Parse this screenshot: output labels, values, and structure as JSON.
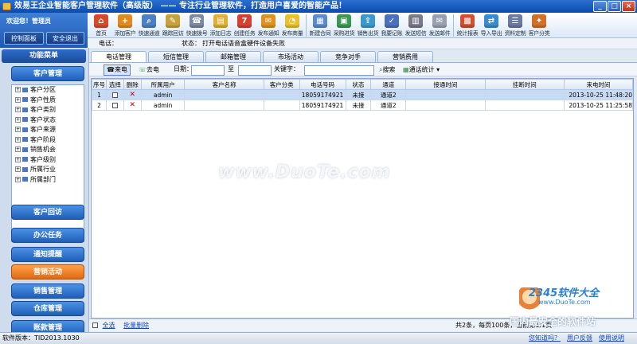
{
  "window": {
    "title": "效易王企业智能客户管理软件（高级版） —— 专注行业管理软件，打造用户喜爱的智能产品！"
  },
  "user_panel": {
    "welcome": "欢迎您！管理员",
    "control_btn": "控制面板",
    "logout_btn": "安全退出"
  },
  "toolbar": [
    {
      "label": "首页",
      "icon": "home-icon",
      "color": "#d84a2a",
      "glyph": "⌂"
    },
    {
      "label": "添加客户",
      "icon": "add-customer-icon",
      "color": "#e08a20",
      "glyph": "+"
    },
    {
      "label": "快速通道",
      "icon": "search-icon",
      "color": "#4a80c8",
      "glyph": "⌕"
    },
    {
      "label": "跟踪回访",
      "icon": "followup-icon",
      "color": "#c8a040",
      "glyph": "✎"
    },
    {
      "label": "快速拨号",
      "icon": "dial-icon",
      "color": "#7a8aa0",
      "glyph": "☎"
    },
    {
      "label": "添加日志",
      "icon": "log-icon",
      "color": "#e0b030",
      "glyph": "▤"
    },
    {
      "label": "创建任务",
      "icon": "calendar-icon",
      "color": "#d84030",
      "glyph": "7"
    },
    {
      "label": "发布通知",
      "icon": "notice-icon",
      "color": "#e09020",
      "glyph": "✉"
    },
    {
      "label": "发布商量",
      "icon": "chat-icon",
      "color": "#e8c030",
      "glyph": "◔"
    },
    {
      "label": "新建合同",
      "icon": "contract-icon",
      "color": "#5a8ad0",
      "glyph": "▦"
    },
    {
      "label": "采购进货",
      "icon": "purchase-icon",
      "color": "#3a9a50",
      "glyph": "▣"
    },
    {
      "label": "销售出货",
      "icon": "sales-icon",
      "color": "#3a9ad0",
      "glyph": "⇪"
    },
    {
      "label": "我要记账",
      "icon": "account-icon",
      "color": "#4a70c0",
      "glyph": "✓"
    },
    {
      "label": "发送短信",
      "icon": "sms-icon",
      "color": "#7a7a8a",
      "glyph": "▥"
    },
    {
      "label": "发送邮件",
      "icon": "mail-icon",
      "color": "#9aa0b0",
      "glyph": "✉"
    },
    {
      "label": "统计报表",
      "icon": "report-icon",
      "color": "#d05030",
      "glyph": "▩"
    },
    {
      "label": "导入导出",
      "icon": "import-export-icon",
      "color": "#3a8ad0",
      "glyph": "⇄"
    },
    {
      "label": "资料定制",
      "icon": "custom-icon",
      "color": "#6a7aa0",
      "glyph": "☰"
    },
    {
      "label": "客户分类",
      "icon": "category-icon",
      "color": "#d0702a",
      "glyph": "✦"
    }
  ],
  "status_line": {
    "phone_label": "电话：",
    "status_label": "状态：",
    "status_value": "打开电话语音盒硬件设备失败"
  },
  "sidebar": {
    "menu_title": "功能菜单",
    "top_button": "客户管理",
    "tree": [
      "客户分区",
      "客户性质",
      "客户类别",
      "客户状态",
      "客户来源",
      "客户阶段",
      "销售机会",
      "客户级别",
      "所属行业",
      "所属部门"
    ],
    "buttons": [
      {
        "label": "客户回访",
        "orange": false
      },
      {
        "label": "办公任务",
        "orange": false
      },
      {
        "label": "通知提醒",
        "orange": false
      },
      {
        "label": "营销活动",
        "orange": true
      },
      {
        "label": "销售管理",
        "orange": false
      },
      {
        "label": "仓库管理",
        "orange": false
      },
      {
        "label": "账款管理",
        "orange": false
      }
    ]
  },
  "tabs": [
    "电话管理",
    "短信管理",
    "邮箱管理",
    "市场活动",
    "竞争对手",
    "营销费用"
  ],
  "filter": {
    "incoming_btn": "来电",
    "outgoing_btn": "去电",
    "date_label": "日期：",
    "to_label": "至",
    "keyword_label": "关键字：",
    "search_btn": "搜索",
    "stats_btn": "通话统计"
  },
  "table": {
    "headers": [
      "序号",
      "选择",
      "删除",
      "所属用户",
      "客户名称",
      "客户分类",
      "电话号码",
      "状态",
      "通道",
      "接通时间",
      "挂断时间",
      "来电时间"
    ],
    "rows": [
      [
        "1",
        "",
        "",
        "admin",
        "",
        "",
        "18059174921",
        "未接",
        "通道2",
        "",
        "",
        "2013-10-25 11:48:20"
      ],
      [
        "2",
        "",
        "",
        "admin",
        "",
        "",
        "18059174921",
        "未接",
        "通道2",
        "",
        "",
        "2013-10-25 11:25:58"
      ]
    ]
  },
  "footer": {
    "select_all": "全选",
    "batch_delete": "批量删除",
    "paging": "共2条，每页100条，当前第1/1页"
  },
  "statusbar": {
    "version": "软件版本：TID2013.1030",
    "knowhow": "您知道吗？",
    "feedback": "用户反馈",
    "help": "使用说明"
  },
  "watermark": {
    "main": "www.DuoTe.com",
    "site": "2345软件大全",
    "site_url": "www.DuoTe.com",
    "slogan": "国内最安全的软件站"
  }
}
